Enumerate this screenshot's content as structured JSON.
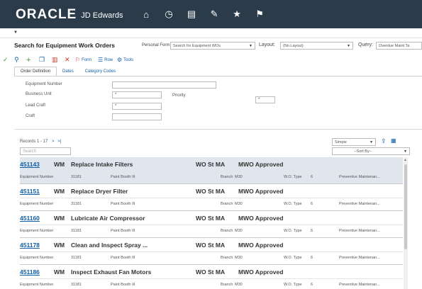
{
  "app": {
    "brand": "ORACLE",
    "product": "JD Edwards"
  },
  "form": {
    "title": "Search for Equipment Work Orders",
    "personal_form_label": "Personal Form:",
    "personal_form_value": "Search for Equipment WOs",
    "layout_label": "Layout:",
    "layout_value": "(No Layout)",
    "query_label": "Query:",
    "query_value": "Overdue Maint Ta"
  },
  "toolbar": {
    "form_label": "Form",
    "row_label": "Row",
    "tools_label": "Tools"
  },
  "tabs": [
    {
      "label": "Order Definition"
    },
    {
      "label": "Dates"
    },
    {
      "label": "Category Codes"
    }
  ],
  "fields": {
    "equipment_number": {
      "label": "Equipment Number",
      "value": ""
    },
    "business_unit": {
      "label": "Business Unit",
      "value": "*"
    },
    "priority": {
      "label": "Priority",
      "value": "*"
    },
    "lead_craft": {
      "label": "Lead Craft",
      "value": "*"
    },
    "craft": {
      "label": "Craft",
      "value": ""
    }
  },
  "grid": {
    "records": "Records 1 - 17",
    "search_placeholder": "Search",
    "view_mode": "Simple",
    "sort_by": "--Sort By--",
    "rows": [
      {
        "wo": "451143",
        "type": "WM",
        "desc": "Replace Intake Filters",
        "status": "WO St MA",
        "approval": "MWO Approved",
        "equip_label": "Equipment Number",
        "equip": "31181",
        "location": "Paint Booth III",
        "branch_label": "Branch",
        "branch": "M30",
        "wo_type_label": "W.O. Type",
        "wo_type": "6",
        "category": "Preventive Maintenan..."
      },
      {
        "wo": "451151",
        "type": "WM",
        "desc": "Replace Dryer Filter",
        "status": "WO St MA",
        "approval": "MWO Approved",
        "equip_label": "Equipment Number",
        "equip": "31181",
        "location": "Paint Booth III",
        "branch_label": "Branch",
        "branch": "M30",
        "wo_type_label": "W.O. Type",
        "wo_type": "6",
        "category": "Preventive Maintenan..."
      },
      {
        "wo": "451160",
        "type": "WM",
        "desc": "Lubricate Air Compressor",
        "status": "WO St MA",
        "approval": "MWO Approved",
        "equip_label": "Equipment Number",
        "equip": "31181",
        "location": "Paint Booth III",
        "branch_label": "Branch",
        "branch": "M30",
        "wo_type_label": "W.O. Type",
        "wo_type": "6",
        "category": "Preventive Maintenan..."
      },
      {
        "wo": "451178",
        "type": "WM",
        "desc": "Clean and Inspect Spray ...",
        "status": "WO St MA",
        "approval": "MWO Approved",
        "equip_label": "Equipment Number",
        "equip": "31181",
        "location": "Paint Booth III",
        "branch_label": "Branch",
        "branch": "M30",
        "wo_type_label": "W.O. Type",
        "wo_type": "6",
        "category": "Preventive Maintenan..."
      },
      {
        "wo": "451186",
        "type": "WM",
        "desc": "Inspect Exhaust Fan Motors",
        "status": "WO St MA",
        "approval": "MWO Approved",
        "equip_label": "Equipment Number",
        "equip": "31181",
        "location": "Paint Booth III",
        "branch_label": "Branch",
        "branch": "M30",
        "wo_type_label": "W.O. Type",
        "wo_type": "6",
        "category": "Preventive Maintenan..."
      }
    ]
  },
  "icons": {
    "home": "home-icon",
    "recent": "clock-icon",
    "reports": "chart-icon",
    "edit": "edit-icon",
    "favorites": "star-icon",
    "flag": "flag-icon"
  },
  "colors": {
    "topbar": "#2b3b4a",
    "link": "#0f5fa6",
    "selected_row": "#dfe6ee",
    "ok_check": "#3a9a3a",
    "add_plus": "#3a9a3a",
    "delete_red": "#c0392b"
  }
}
